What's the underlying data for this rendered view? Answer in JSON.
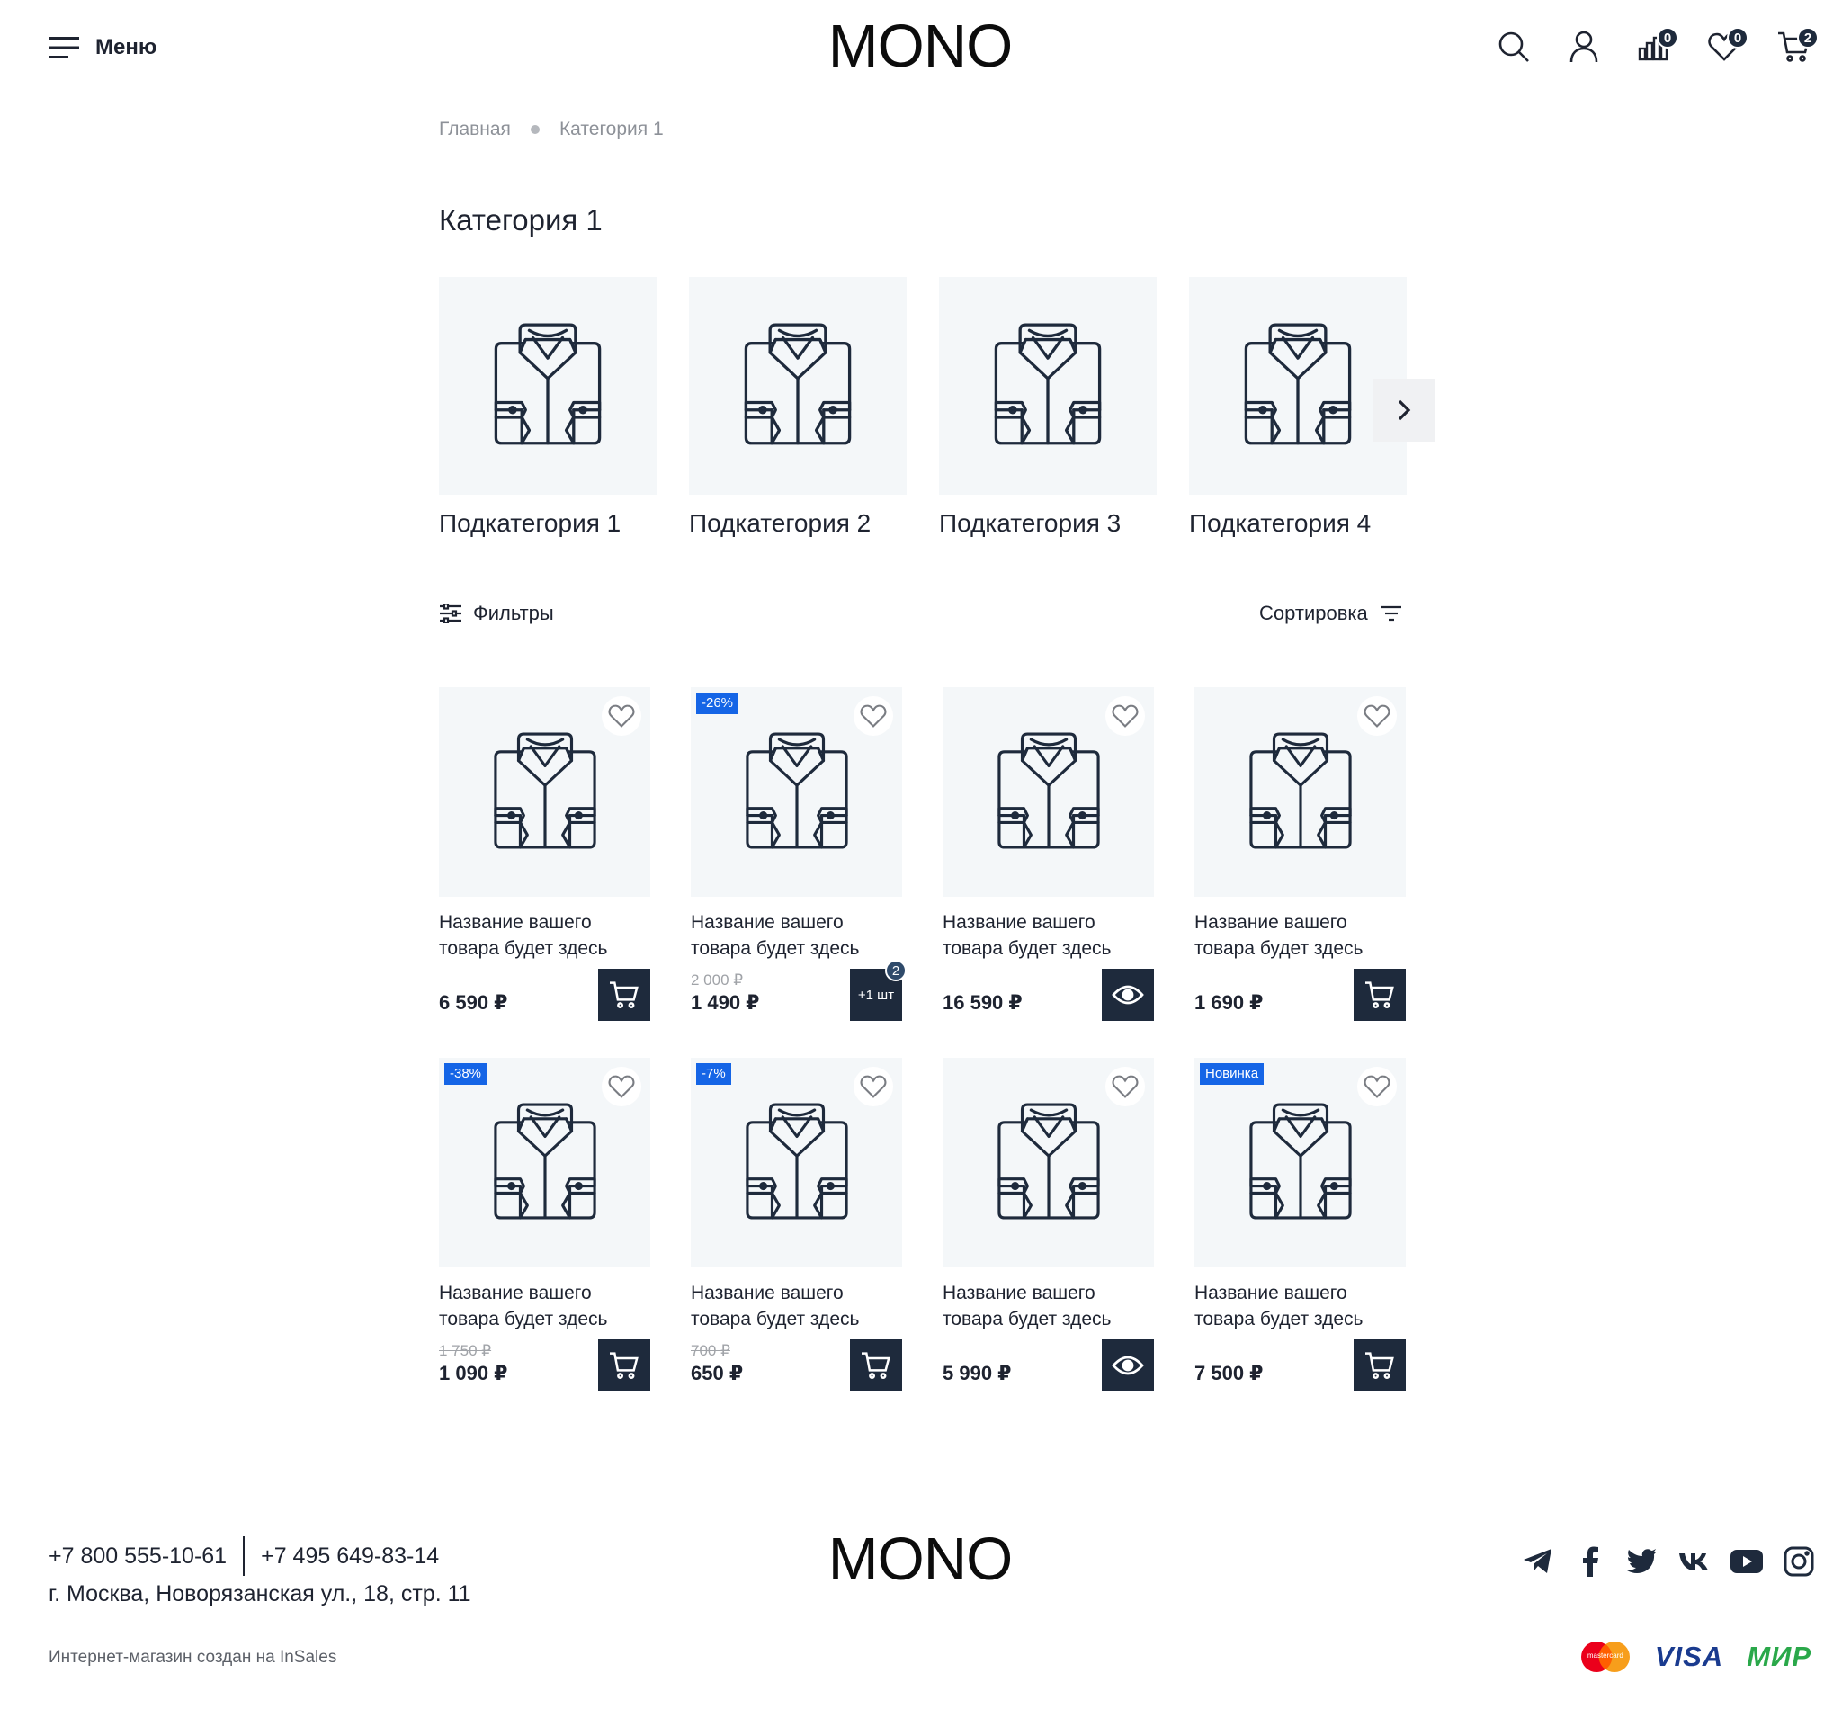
{
  "header": {
    "menu_label": "Меню",
    "logo_text": "MONO",
    "icons": {
      "search": "search-icon",
      "account": "user-icon",
      "compare": "compare-icon",
      "favorites": "heart-icon",
      "cart": "cart-icon"
    },
    "compare_count": "0",
    "favorites_count": "0",
    "cart_count": "2"
  },
  "breadcrumb": {
    "home": "Главная",
    "current": "Категория 1"
  },
  "page_title": "Категория 1",
  "subcategories": [
    {
      "name": "Подкатегория 1"
    },
    {
      "name": "Подкатегория 2"
    },
    {
      "name": "Подкатегория 3"
    },
    {
      "name": "Подкатегория 4"
    }
  ],
  "toolbar": {
    "filters_label": "Фильтры",
    "sort_label": "Сортировка"
  },
  "products": [
    {
      "name": "Название вашего товара будет здесь",
      "badge": "",
      "old_price": "",
      "price": "6 590 ₽",
      "action": "cart"
    },
    {
      "name": "Название вашего товара будет здесь",
      "badge": "-26%",
      "old_price": "2 000 ₽",
      "price": "1 490 ₽",
      "action": "quantity",
      "action_label": "+1 шт",
      "action_count": "2"
    },
    {
      "name": "Название вашего товара будет здесь",
      "badge": "",
      "old_price": "",
      "price": "16 590 ₽",
      "action": "view"
    },
    {
      "name": "Название вашего товара будет здесь",
      "badge": "",
      "old_price": "",
      "price": "1 690 ₽",
      "action": "cart"
    },
    {
      "name": "Название вашего товара будет здесь",
      "badge": "-38%",
      "old_price": "1 750 ₽",
      "price": "1 090 ₽",
      "action": "cart"
    },
    {
      "name": "Название вашего товара будет здесь",
      "badge": "-7%",
      "old_price": "700 ₽",
      "price": "650 ₽",
      "action": "cart"
    },
    {
      "name": "Название вашего товара будет здесь",
      "badge": "",
      "old_price": "",
      "price": "5 990 ₽",
      "action": "view"
    },
    {
      "name": "Название вашего товара будет здесь",
      "badge": "Новинка",
      "old_price": "",
      "price": "7 500 ₽",
      "action": "cart"
    }
  ],
  "footer": {
    "phone_1": "+7 800 555-10-61",
    "phone_2": "+7 495 649-83-14",
    "address": "г. Москва, Новорязанская ул., 18, стр. 11",
    "logo_text": "MONO",
    "credit": "Интернет-магазин создан на InSales",
    "socials": [
      "telegram-icon",
      "facebook-icon",
      "twitter-icon",
      "vk-icon",
      "youtube-icon",
      "instagram-icon"
    ],
    "payments": {
      "mastercard_label": "mastercard",
      "visa": "VISA",
      "mir": "МИР"
    }
  },
  "colors": {
    "accent_dark": "#1e2a3c",
    "badge_blue": "#1565e6",
    "image_bg": "#f4f7f9"
  }
}
